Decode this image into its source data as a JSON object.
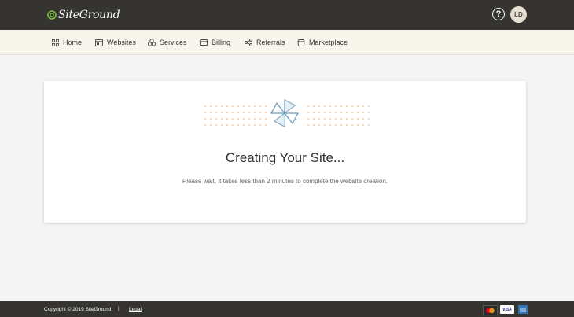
{
  "header": {
    "logo_text": "SiteGround",
    "help_symbol": "?",
    "avatar_initials": "LD"
  },
  "nav": {
    "items": [
      {
        "label": "Home",
        "icon": "grid-icon"
      },
      {
        "label": "Websites",
        "icon": "website-icon"
      },
      {
        "label": "Services",
        "icon": "services-icon"
      },
      {
        "label": "Billing",
        "icon": "billing-icon"
      },
      {
        "label": "Referrals",
        "icon": "share-icon"
      },
      {
        "label": "Marketplace",
        "icon": "marketplace-icon"
      }
    ]
  },
  "main": {
    "title": "Creating Your Site...",
    "subtitle": "Please wait, it takes less than 2 minutes to complete the website creation."
  },
  "footer": {
    "copyright": "Copyright © 2019 SiteGround",
    "separator": "|",
    "legal_label": "Legal",
    "payment_cards": [
      "mastercard-icon",
      "visa-icon",
      "amex-icon"
    ],
    "visa_text": "VISA"
  },
  "colors": {
    "header_bg": "#363431",
    "nav_bg": "#f7f5ec",
    "accent_green": "#7cbd42",
    "dot_orange": "#e8a35e",
    "pinwheel_blue": "#6b9bb8"
  }
}
